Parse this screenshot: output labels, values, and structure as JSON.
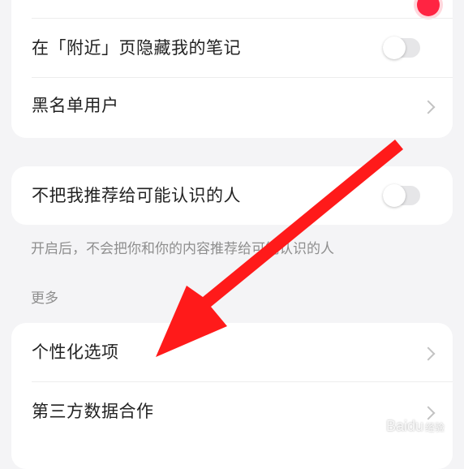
{
  "privacy": {
    "hide_nearby_label": "在「附近」页隐藏我的笔记",
    "hide_nearby_on": false,
    "blacklist_label": "黑名单用户"
  },
  "recommend": {
    "label": "不把我推荐给可能认识的人",
    "on": false,
    "hint": "开启后，不会把你和你的内容推荐给可能认识的人"
  },
  "more": {
    "section_title": "更多",
    "personalization_label": "个性化选项",
    "third_party_label": "第三方数据合作"
  },
  "watermark": {
    "brand": "Baidu",
    "sub": "经验"
  },
  "colors": {
    "accent": "#ff2442",
    "arrow": "#ff1a1a"
  }
}
